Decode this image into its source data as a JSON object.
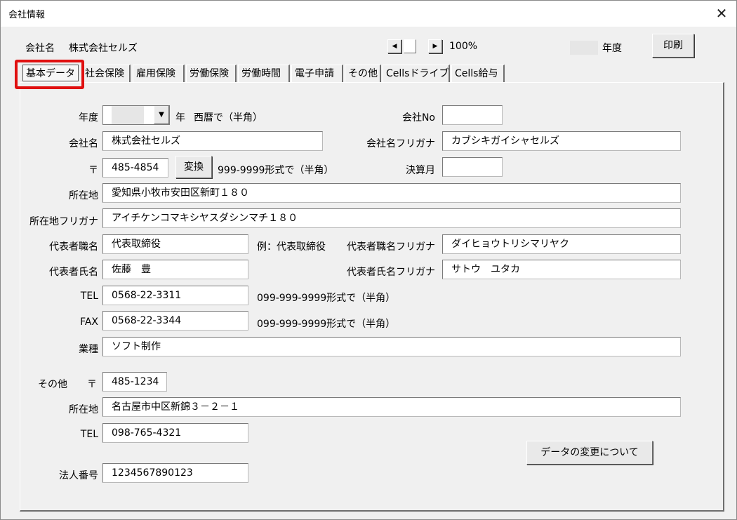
{
  "window": {
    "title": "会社情報",
    "close_label": "✕"
  },
  "header": {
    "company_label": "会社名",
    "company_name": "株式会社セルズ",
    "zoom": "100%",
    "year_suffix": "年度",
    "print_label": "印刷"
  },
  "tabs": [
    {
      "label": "基本データ",
      "active": true
    },
    {
      "label": "社会保険"
    },
    {
      "label": "雇用保険"
    },
    {
      "label": "労働保険"
    },
    {
      "label": "労働時間"
    },
    {
      "label": "電子申請"
    },
    {
      "label": "その他"
    },
    {
      "label": "Cellsドライブ"
    },
    {
      "label": "Cells給与"
    }
  ],
  "form": {
    "year": {
      "label": "年度",
      "suffix": "年",
      "hint": "西暦で（半角）"
    },
    "company_no": {
      "label": "会社No",
      "value": ""
    },
    "company_name": {
      "label": "会社名",
      "value": "株式会社セルズ"
    },
    "company_kana": {
      "label": "会社名フリガナ",
      "value": "カブシキガイシャセルズ"
    },
    "postal": {
      "label": "〒",
      "value": "485-4854",
      "convert_label": "変換",
      "hint": "999-9999形式で（半角）"
    },
    "closing_month": {
      "label": "決算月",
      "value": ""
    },
    "address": {
      "label": "所在地",
      "value": "愛知県小牧市安田区新町１８０"
    },
    "address_kana": {
      "label": "所在地フリガナ",
      "value": "アイチケンコマキシヤスダシンマチ１８０"
    },
    "rep_title": {
      "label": "代表者職名",
      "value": "代表取締役",
      "example": "例：代表取締役"
    },
    "rep_title_kana": {
      "label": "代表者職名フリガナ",
      "value": "ダイヒョウトリシマリヤク"
    },
    "rep_name": {
      "label": "代表者氏名",
      "value": "佐藤　豊"
    },
    "rep_name_kana": {
      "label": "代表者氏名フリガナ",
      "value": "サトウ　ユタカ"
    },
    "tel": {
      "label": "TEL",
      "value": "0568-22-3311",
      "hint": "099-999-9999形式で（半角）"
    },
    "fax": {
      "label": "FAX",
      "value": "0568-22-3344",
      "hint": "099-999-9999形式で（半角）"
    },
    "industry": {
      "label": "業種",
      "value": "ソフト制作"
    },
    "other": {
      "label": "その他",
      "postal_label": "〒",
      "postal": "485-1234",
      "address_label": "所在地",
      "address": "名古屋市中区新錦３－２－１",
      "tel_label": "TEL",
      "tel": "098-765-4321"
    },
    "corp_no": {
      "label": "法人番号",
      "value": "1234567890123"
    },
    "data_change_label": "データの変更について"
  },
  "colors": {
    "highlight": "#e01010",
    "window_bg": "#f0f0f0"
  }
}
